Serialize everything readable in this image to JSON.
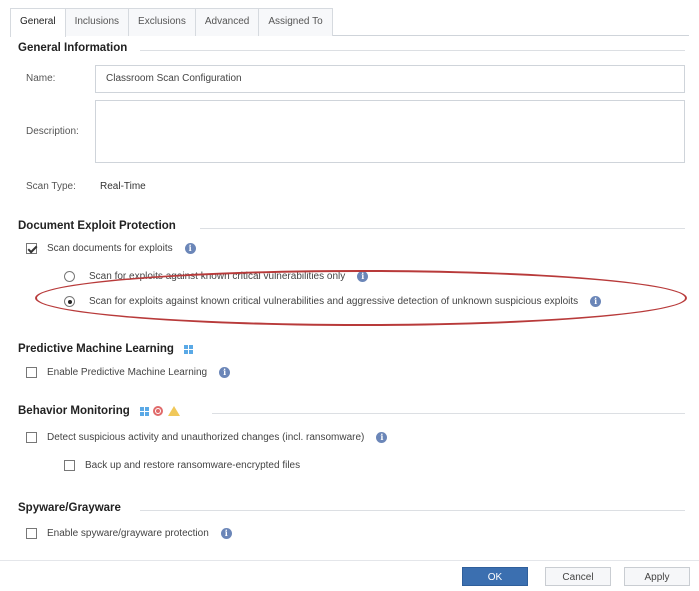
{
  "tabs": [
    {
      "label": "General",
      "active": true
    },
    {
      "label": "Inclusions"
    },
    {
      "label": "Exclusions"
    },
    {
      "label": "Advanced"
    },
    {
      "label": "Assigned To"
    }
  ],
  "general_info": {
    "title": "General Information",
    "name_label": "Name:",
    "name_value": "Classroom Scan Configuration",
    "description_label": "Description:",
    "description_value": "",
    "scan_type_label": "Scan Type:",
    "scan_type_value": "Real-Time"
  },
  "document_exploit": {
    "title": "Document Exploit Protection",
    "scan_documents": {
      "label": "Scan documents for exploits",
      "checked": true
    },
    "option_known": {
      "label": "Scan for exploits against known critical vulnerabilities only",
      "selected": false
    },
    "option_aggressive": {
      "label": "Scan for exploits against known critical vulnerabilities and aggressive detection of unknown suspicious exploits",
      "selected": true
    }
  },
  "predictive_ml": {
    "title": "Predictive Machine Learning",
    "enable": {
      "label": "Enable Predictive Machine Learning",
      "checked": false
    }
  },
  "behavior_monitoring": {
    "title": "Behavior Monitoring",
    "detect": {
      "label": "Detect suspicious activity and unauthorized changes (incl. ransomware)",
      "checked": false
    },
    "backup": {
      "label": "Back up and restore ransomware-encrypted files",
      "checked": false
    }
  },
  "spyware": {
    "title": "Spyware/Grayware",
    "enable": {
      "label": "Enable spyware/grayware protection",
      "checked": false
    }
  },
  "buttons": {
    "ok": "OK",
    "cancel": "Cancel",
    "apply": "Apply"
  },
  "colors": {
    "primary_button": "#3b6fb0",
    "annotation_ellipse": "#b83a3a",
    "info_icon": "#6b86b8"
  }
}
